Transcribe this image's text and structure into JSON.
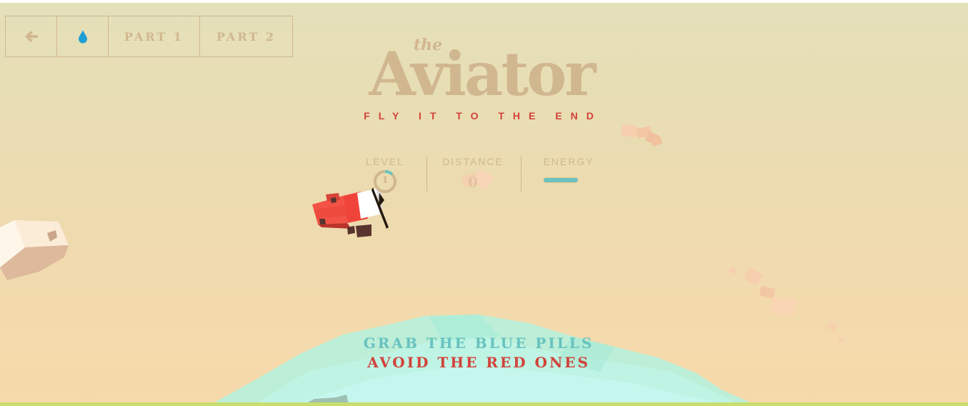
{
  "nav": {
    "back_icon": "arrow-left-icon",
    "drop_icon": "water-drop-icon",
    "part1_label": "PART 1",
    "part2_label": "PART 2"
  },
  "header": {
    "title_small": "the",
    "title": "Aviator",
    "subtitle": "FLY IT TO THE END"
  },
  "score": {
    "level_label": "LEVEL",
    "level_value": "1",
    "distance_label": "DISTANCE",
    "distance_value": "0",
    "energy_label": "ENERGY",
    "energy_fraction": 1.0
  },
  "instructions": {
    "line1": "GRAB THE BLUE PILLS",
    "line2": "AVOID THE RED ONES"
  },
  "colors": {
    "accent_tan": "#d1b790",
    "red": "#d1433a",
    "blue_pill": "#68c3c0",
    "sky_top": "#e4e0ba",
    "sky_bottom": "#f7d9aa",
    "sea": "#a8ecd8",
    "plane_red": "#f25346",
    "plane_white": "#ffffff",
    "cloud": "#f5cfae"
  }
}
